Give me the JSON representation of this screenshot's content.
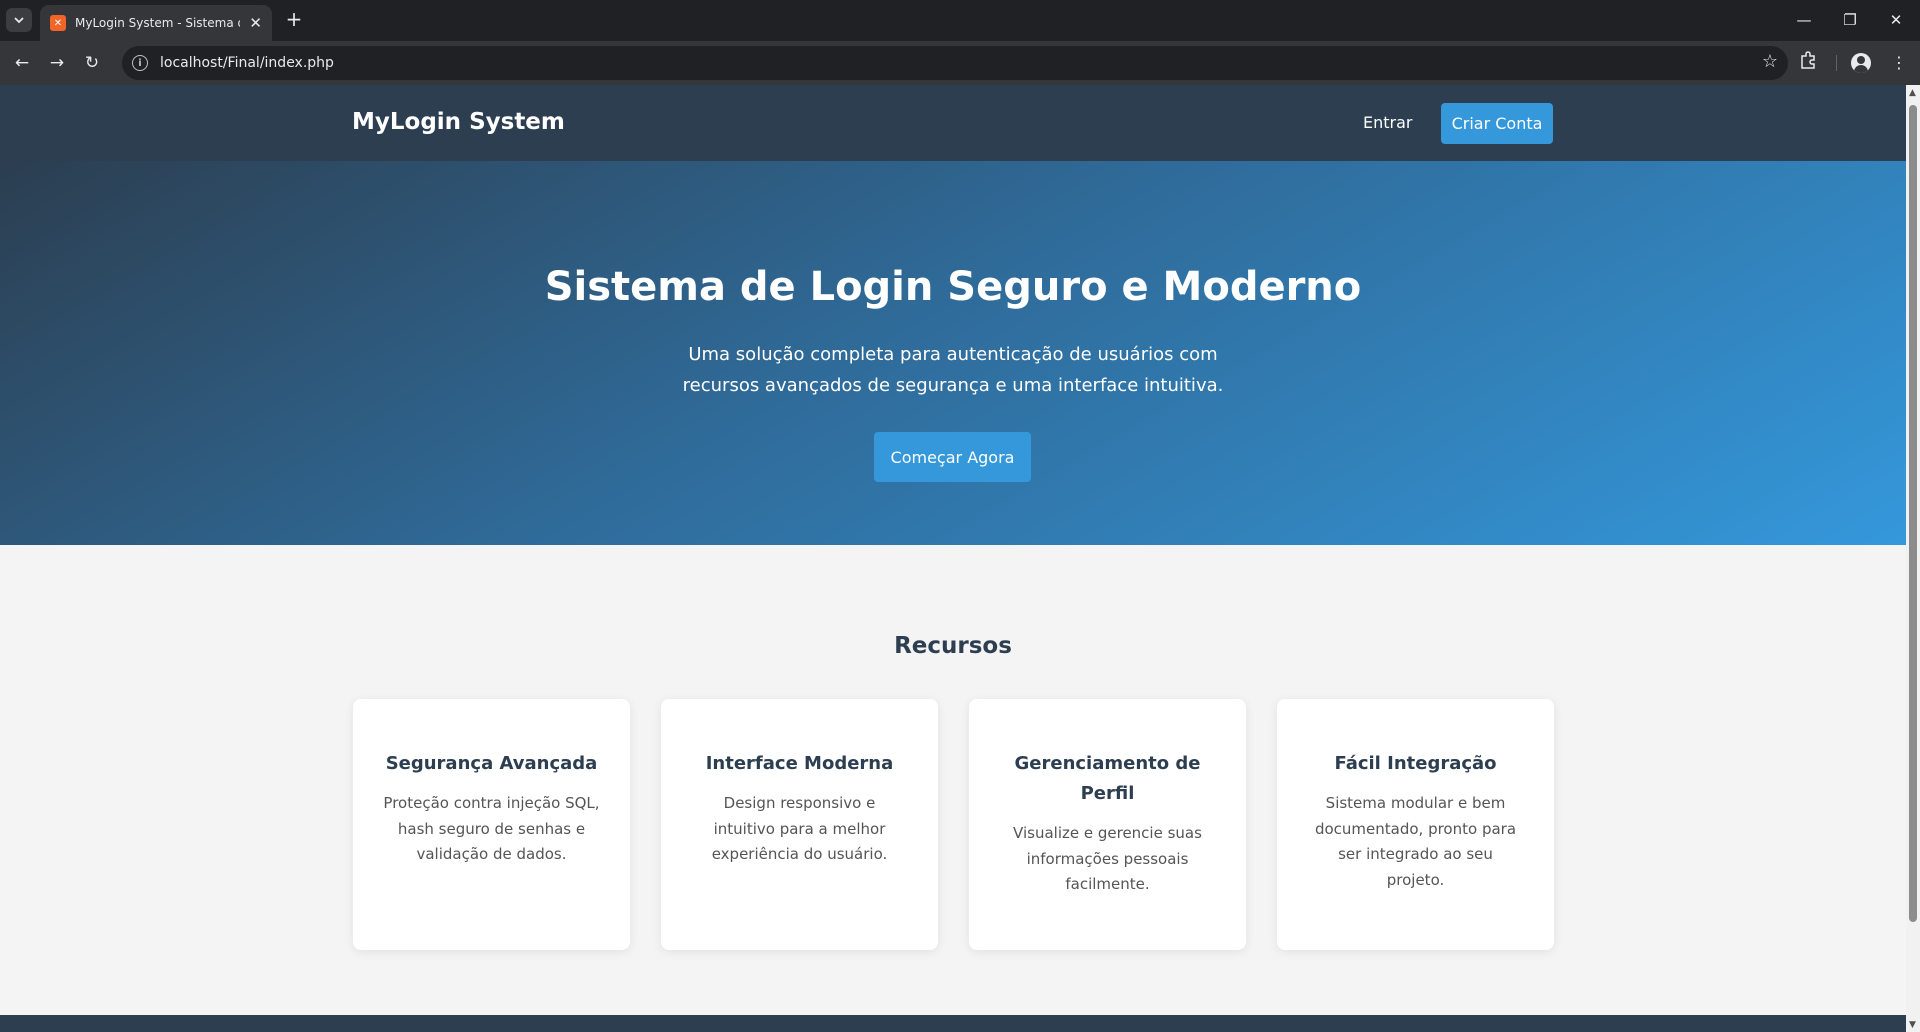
{
  "browser": {
    "tab_title": "MyLogin System - Sistema de Login",
    "url": "localhost/Final/index.php"
  },
  "header": {
    "brand": "MyLogin System",
    "login_link": "Entrar",
    "signup_button": "Criar Conta"
  },
  "hero": {
    "title": "Sistema de Login Seguro e Moderno",
    "subtitle": "Uma solução completa para autenticação de usuários com recursos avançados de segurança e uma interface intuitiva.",
    "cta": "Começar Agora"
  },
  "features": {
    "title": "Recursos",
    "cards": [
      {
        "title": "Segurança Avançada",
        "text": "Proteção contra injeção SQL, hash seguro de senhas e validação de dados."
      },
      {
        "title": "Interface Moderna",
        "text": "Design responsivo e intuitivo para a melhor experiência do usuário."
      },
      {
        "title": "Gerenciamento de Perfil",
        "text": "Visualize e gerencie suas informações pessoais facilmente."
      },
      {
        "title": "Fácil Integração",
        "text": "Sistema modular e bem documentado, pronto para ser integrado ao seu projeto."
      }
    ]
  },
  "colors": {
    "header_bg": "#2c3e50",
    "accent": "#3498db",
    "page_bg": "#f4f4f4"
  }
}
